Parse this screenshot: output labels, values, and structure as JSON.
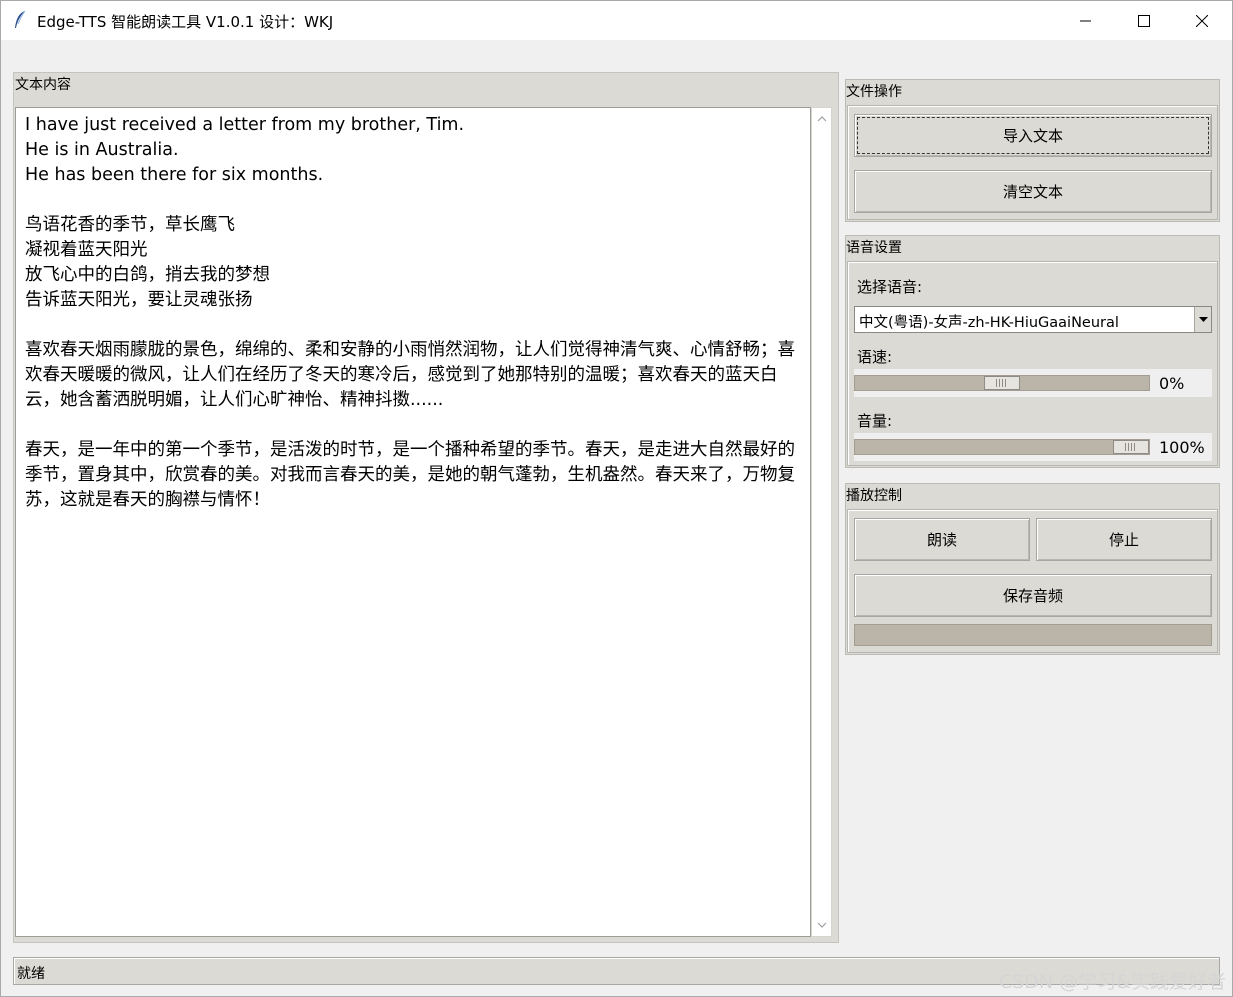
{
  "window": {
    "title": "Edge-TTS 智能朗读工具 V1.0.1 设计：WKJ",
    "icon": "feather-icon",
    "controls": [
      "minimize-icon",
      "maximize-icon",
      "close-icon"
    ]
  },
  "text_panel": {
    "label": "文本内容",
    "lines": [
      "I have just received a letter from my brother, Tim.",
      "He is in Australia.",
      "He has been there for six months.",
      "",
      "鸟语花香的季节，草长鹰飞",
      "凝视着蓝天阳光",
      "放飞心中的白鸽，捎去我的梦想",
      "告诉蓝天阳光，要让灵魂张扬",
      "",
      "喜欢春天烟雨朦胧的景色，绵绵的、柔和安静的小雨悄然润物，让人们觉得神清气爽、心情舒畅；喜欢春天暖暖的微风，让人们在经历了冬天的寒冷后，感觉到了她那特别的温暖；喜欢春天的蓝天白云，她含蓄洒脱明媚，让人们心旷神怡、精神抖擞......",
      "",
      "春天，是一年中的第一个季节，是活泼的时节，是一个播种希望的季节。春天，是走进大自然最好的季节，置身其中，欣赏春的美。对我而言春天的美，是她的朝气蓬勃，生机盎然。春天来了，万物复苏，这就是春天的胸襟与情怀！"
    ]
  },
  "file_ops": {
    "label": "文件操作",
    "import_button": "导入文本",
    "clear_button": "清空文本"
  },
  "voice_settings": {
    "label": "语音设置",
    "voice_label": "选择语音:",
    "voice_value": "中文(粤语)-女声-zh-HK-HiuGaaiNeural",
    "rate_label": "语速:",
    "rate_value": "0%",
    "rate_position": 0.5,
    "volume_label": "音量:",
    "volume_value": "100%",
    "volume_position": 1.0
  },
  "playback": {
    "label": "播放控制",
    "read_button": "朗读",
    "stop_button": "停止",
    "save_button": "保存音频",
    "progress": 0
  },
  "status_bar": {
    "text": "就绪"
  },
  "watermark": "CSDN @学习&实践爱好者",
  "colors": {
    "frame_bg": "#dcdad5",
    "trough": "#bab4a9",
    "window_bg": "#f0f0f0"
  }
}
